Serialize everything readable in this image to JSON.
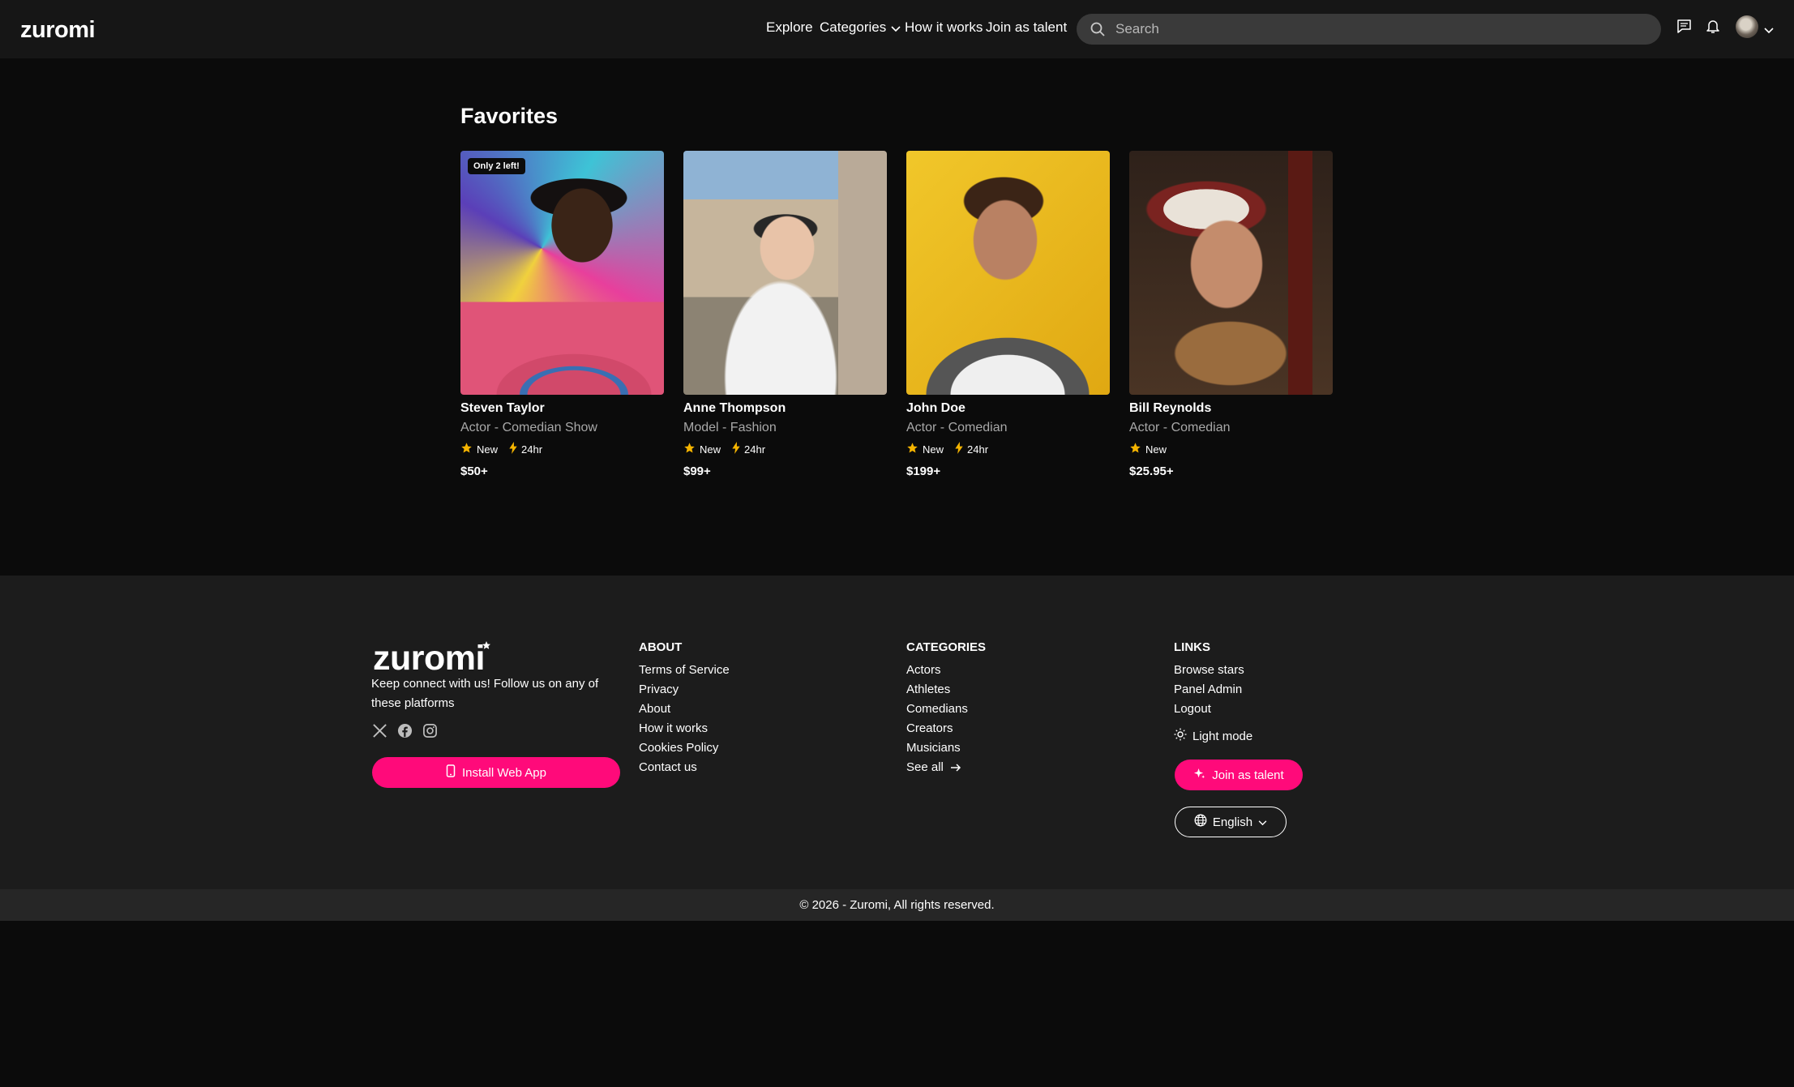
{
  "header": {
    "logo": "zuromi",
    "nav": {
      "explore": "Explore",
      "categories": "Categories",
      "how_it_works": "How it works",
      "join_as_talent": "Join as talent"
    },
    "search": {
      "placeholder": "Search",
      "value": ""
    },
    "icons": [
      "search-icon",
      "message-icon",
      "bell-icon",
      "avatar",
      "chevron-down-icon"
    ]
  },
  "favorites": {
    "title": "Favorites",
    "cards": [
      {
        "badge": "Only 2 left!",
        "name": "Steven Taylor",
        "role": "Actor - Comedian Show",
        "new_label": "New",
        "fast_label": "24hr",
        "price": "$50+"
      },
      {
        "badge": "",
        "name": "Anne Thompson",
        "role": "Model - Fashion",
        "new_label": "New",
        "fast_label": "24hr",
        "price": "$99+"
      },
      {
        "badge": "",
        "name": "John Doe",
        "role": "Actor - Comedian",
        "new_label": "New",
        "fast_label": "24hr",
        "price": "$199+"
      },
      {
        "badge": "",
        "name": "Bill Reynolds",
        "role": "Actor - Comedian",
        "new_label": "New",
        "fast_label": "",
        "price": "$25.95+"
      }
    ]
  },
  "footer": {
    "logo": "zuromi",
    "tagline": "Keep connect with us! Follow us on any of these platforms",
    "install_button": "Install Web App",
    "about": {
      "title": "ABOUT",
      "items": [
        "Terms of Service",
        "Privacy",
        "About",
        "How it works",
        "Cookies Policy",
        "Contact us"
      ]
    },
    "categories": {
      "title": "CATEGORIES",
      "items": [
        "Actors",
        "Athletes",
        "Comedians",
        "Creators",
        "Musicians",
        "See all"
      ]
    },
    "links": {
      "title": "LINKS",
      "items": [
        "Browse stars",
        "Panel Admin",
        "Logout"
      ],
      "light_mode": "Light mode",
      "join_button": "Join as talent",
      "language": "English"
    },
    "copyright": "© 2026 - Zuromi, All rights reserved."
  },
  "colors": {
    "accent": "#ff0a7a",
    "star": "#f5b400",
    "background": "#0b0b0b",
    "footer": "#1c1c1c"
  }
}
